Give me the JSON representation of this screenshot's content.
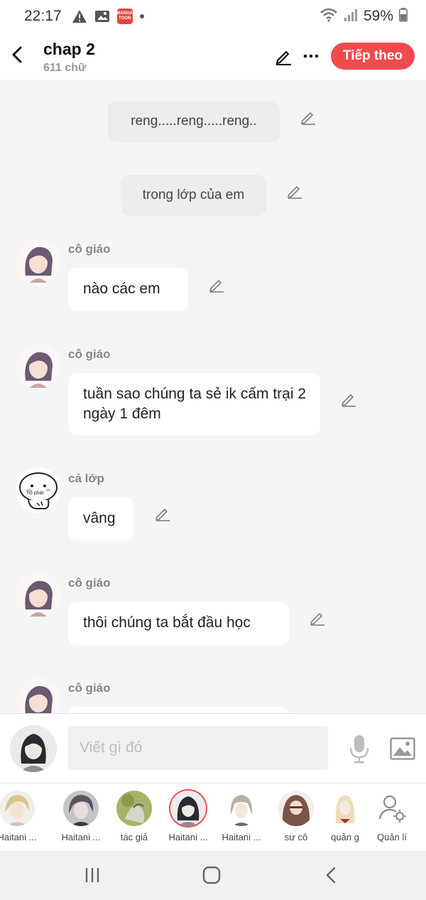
{
  "status_bar": {
    "time": "22:17",
    "icons": [
      "warning-icon",
      "gallery-icon",
      "mangatoon-icon",
      "dot-icon"
    ],
    "manga_icon_text": "MANGA TOON",
    "battery": "59%"
  },
  "header": {
    "title": "chap 2",
    "subtitle": "611 chữ",
    "next_button": "Tiếp theo"
  },
  "messages": [
    {
      "type": "narration",
      "text": "reng.....reng.....reng.."
    },
    {
      "type": "narration",
      "text": "trong lớp của em"
    },
    {
      "type": "message",
      "sender": "cô giáo",
      "text": "nào các em"
    },
    {
      "type": "message",
      "sender": "cô giáo",
      "text": "tuần sao chúng ta sẻ ik cấm trại 2 ngày 1 đêm"
    },
    {
      "type": "message",
      "sender": "cả lớp",
      "text": "vâng"
    },
    {
      "type": "message",
      "sender": "cô giáo",
      "text": "thôi chúng ta bắt đầu học"
    },
    {
      "type": "message",
      "sender": "cô giáo",
      "text": ""
    }
  ],
  "class_avatar_text": "hổ phát",
  "composer": {
    "placeholder": "Viết gì đó"
  },
  "characters": [
    {
      "name": "Haitani ..."
    },
    {
      "name": "Haitani ..."
    },
    {
      "name": "tác giả"
    },
    {
      "name": "Haitani ...",
      "selected": true
    },
    {
      "name": "Haitani ..."
    },
    {
      "name": "sư cô"
    },
    {
      "name": "quản g"
    },
    {
      "name": "Quản lí"
    }
  ],
  "colors": {
    "accent": "#f04a4d",
    "chat_background": "#f5f5f5",
    "narration_bubble": "#ececec"
  }
}
